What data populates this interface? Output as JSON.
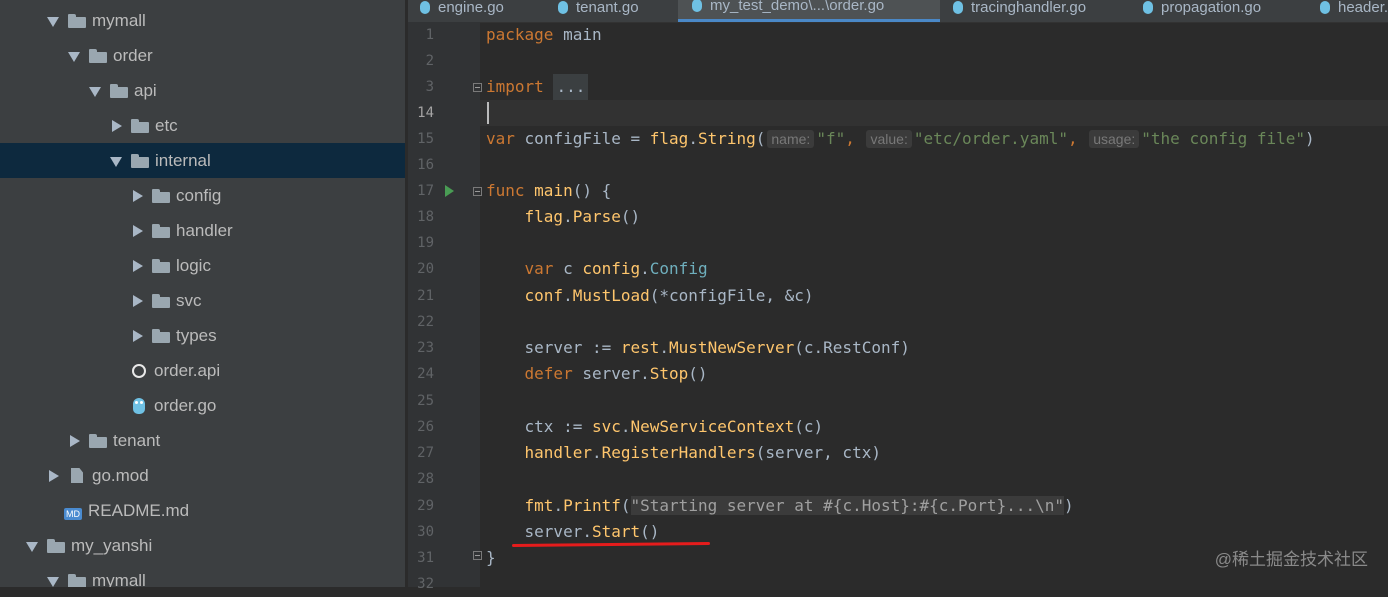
{
  "project_tree": {
    "items": [
      {
        "label": "mymall",
        "kind": "folder",
        "expanded": true
      },
      {
        "label": "order",
        "kind": "folder",
        "expanded": true
      },
      {
        "label": "api",
        "kind": "folder",
        "expanded": true
      },
      {
        "label": "etc",
        "kind": "folder",
        "expanded": false
      },
      {
        "label": "internal",
        "kind": "folder",
        "expanded": true,
        "selected": true
      },
      {
        "label": "config",
        "kind": "folder",
        "expanded": false
      },
      {
        "label": "handler",
        "kind": "folder",
        "expanded": false
      },
      {
        "label": "logic",
        "kind": "folder",
        "expanded": false
      },
      {
        "label": "svc",
        "kind": "folder",
        "expanded": false
      },
      {
        "label": "types",
        "kind": "folder",
        "expanded": false
      },
      {
        "label": "order.api",
        "kind": "api-file"
      },
      {
        "label": "order.go",
        "kind": "go-file"
      },
      {
        "label": "tenant",
        "kind": "folder",
        "expanded": false
      },
      {
        "label": "go.mod",
        "kind": "mod-file"
      },
      {
        "label": "README.md",
        "kind": "md-file"
      },
      {
        "label": "my_yanshi",
        "kind": "folder",
        "expanded": true
      },
      {
        "label": "mymall",
        "kind": "folder",
        "expanded": true
      }
    ]
  },
  "editor": {
    "tabs": [
      {
        "label": "engine.go",
        "active": false
      },
      {
        "label": "tenant.go",
        "active": false
      },
      {
        "label": "my_test_demo\\...\\order.go",
        "active": true
      },
      {
        "label": "tracinghandler.go",
        "active": false
      },
      {
        "label": "propagation.go",
        "active": false
      },
      {
        "label": "header.go",
        "active": false
      }
    ],
    "line_numbers": [
      "1",
      "2",
      "3",
      "14",
      "15",
      "16",
      "17",
      "18",
      "19",
      "20",
      "21",
      "22",
      "23",
      "24",
      "25",
      "26",
      "27",
      "28",
      "29",
      "30",
      "31",
      "32"
    ],
    "current_line": "14",
    "code": {
      "l1_kw": "package",
      "l1_name": "main",
      "l3_kw": "import",
      "l3_fold": "...",
      "l15_kw": "var",
      "l15_name": "configFile",
      "l15_eq": " = ",
      "l15_pkg": "flag",
      "l15_fn": "String",
      "l15_open": "(",
      "l15_h1": "name:",
      "l15_s1": "\"f\"",
      "l15_c1": ", ",
      "l15_h2": "value:",
      "l15_s2": "\"etc/order.yaml\"",
      "l15_c2": ", ",
      "l15_h3": "usage:",
      "l15_s3": "\"the config file\"",
      "l15_close": ")",
      "l17_kw": "func",
      "l17_fn": "main",
      "l17_rest": "() {",
      "l18_pkg": "flag",
      "l18_fn": "Parse",
      "l18_rest": "()",
      "l20_kw": "var",
      "l20_name": " c ",
      "l20_pkg": "config",
      "l20_typ": "Config",
      "l21_pkg": "conf",
      "l21_fn": "MustLoad",
      "l21_rest": "(*configFile, &c)",
      "l23_name": "server := ",
      "l23_pkg": "rest",
      "l23_fn": "MustNewServer",
      "l23_rest": "(c.RestConf)",
      "l24_kw": "defer",
      "l24_name": " server.",
      "l24_fn": "Stop",
      "l24_rest": "()",
      "l26_name": "ctx := ",
      "l26_pkg": "svc",
      "l26_fn": "NewServiceContext",
      "l26_rest": "(c)",
      "l27_pkg": "handler",
      "l27_fn": "RegisterHandlers",
      "l27_rest": "(server, ctx)",
      "l29_pkg": "fmt",
      "l29_fn": "Printf",
      "l29_open": "(",
      "l29_str": "\"Starting server at #{c.Host}:#{c.Port}...\\n\"",
      "l29_close": ")",
      "l30_name": "server.",
      "l30_fn": "Start",
      "l30_rest": "()",
      "l31_text": "}"
    }
  },
  "watermark": "@稀土掘金技术社区",
  "colors": {
    "keyword": "#cc7832",
    "function": "#ffc66d",
    "string": "#6a8759",
    "type": "#6fafbd",
    "selection": "#0d293e",
    "annotation": "#e51c1c"
  }
}
